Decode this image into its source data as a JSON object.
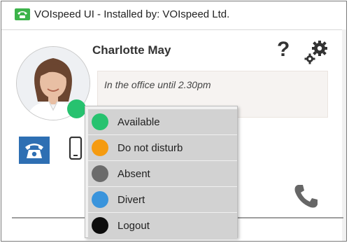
{
  "window": {
    "title": "VOIspeed UI - Installed by: VOIspeed Ltd.",
    "app_icon": "phone-app-icon",
    "accent_color": "#3cb34a"
  },
  "profile": {
    "name": "Charlotte May",
    "status_message": "In the office until 2.30pm",
    "presence_color": "#27c26f"
  },
  "toolbar": {
    "help_label": "?",
    "help_icon": "question-mark-icon",
    "settings_icon": "gear-icon"
  },
  "actions": {
    "desk_phone_icon": "desk-phone-icon",
    "mobile_icon": "mobile-phone-icon",
    "call_icon": "handset-icon",
    "desk_phone_color": "#2e6fb3"
  },
  "status_menu": {
    "items": [
      {
        "label": "Available",
        "color": "#27c26f"
      },
      {
        "label": "Do not disturb",
        "color": "#f59b10"
      },
      {
        "label": "Absent",
        "color": "#6b6b6b"
      },
      {
        "label": "Divert",
        "color": "#3a94dc"
      },
      {
        "label": "Logout",
        "color": "#0d0d0d"
      }
    ]
  }
}
